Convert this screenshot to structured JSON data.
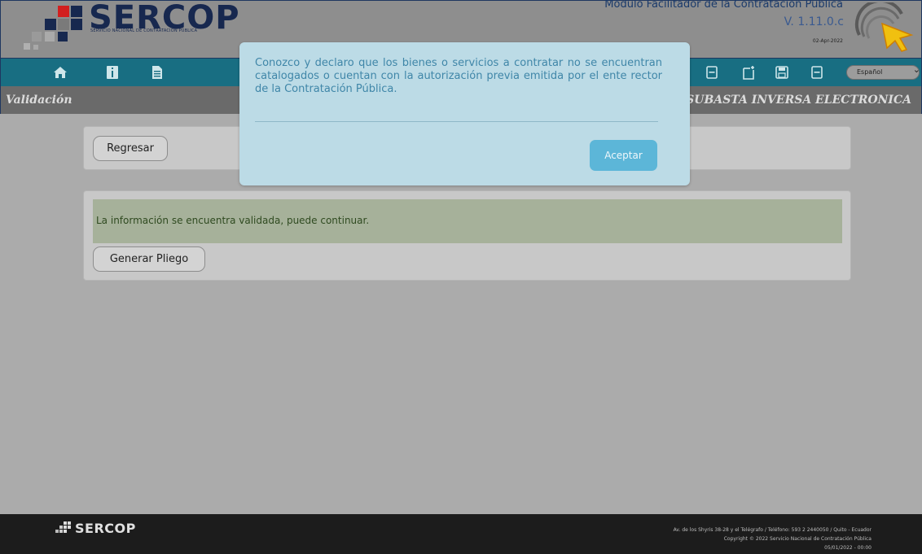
{
  "header": {
    "logo_text": "SERCOP",
    "logo_subtitle": "SERVICIO NACIONAL DE CONTRATACIÓN PÚBLICA",
    "app_title": "Módulo Facilitador de la Contratación Pública",
    "version": "V. 1.11.0.c",
    "date": "02-Apr-2022"
  },
  "toolbar": {
    "icons": [
      "home-icon",
      "info-icon",
      "document-icon",
      "form-icon",
      "new-document-icon",
      "save-icon",
      "form-icon"
    ],
    "language": "Español"
  },
  "section": {
    "left_title": "Validación",
    "right_title": "- SUBASTA INVERSA ELECTRONICA"
  },
  "content": {
    "back_button": "Regresar",
    "validation_message": "La información se encuentra validada, puede continuar.",
    "generate_button": "Generar Pliego"
  },
  "modal": {
    "message": "Conozco y declaro que los bienes o servicios a contratar no se encuentran catalogados o cuentan con la autorización previa emitida por el ente rector de la Contratación Pública.",
    "accept_button": "Aceptar"
  },
  "footer": {
    "logo_text": "SERCOP",
    "address": "Av. de los Shyris 38-28 y el Telégrafo / Teléfono: 593 2 2440050 / Quito - Ecuador",
    "copyright": "Copyright © 2022 Servicio Nacional de Contratación Pública",
    "datetime": "05/01/2022 - 00:00"
  },
  "colors": {
    "accent": "#5cb6d8",
    "toolbar": "#186e82",
    "brand_navy": "#17284f"
  }
}
